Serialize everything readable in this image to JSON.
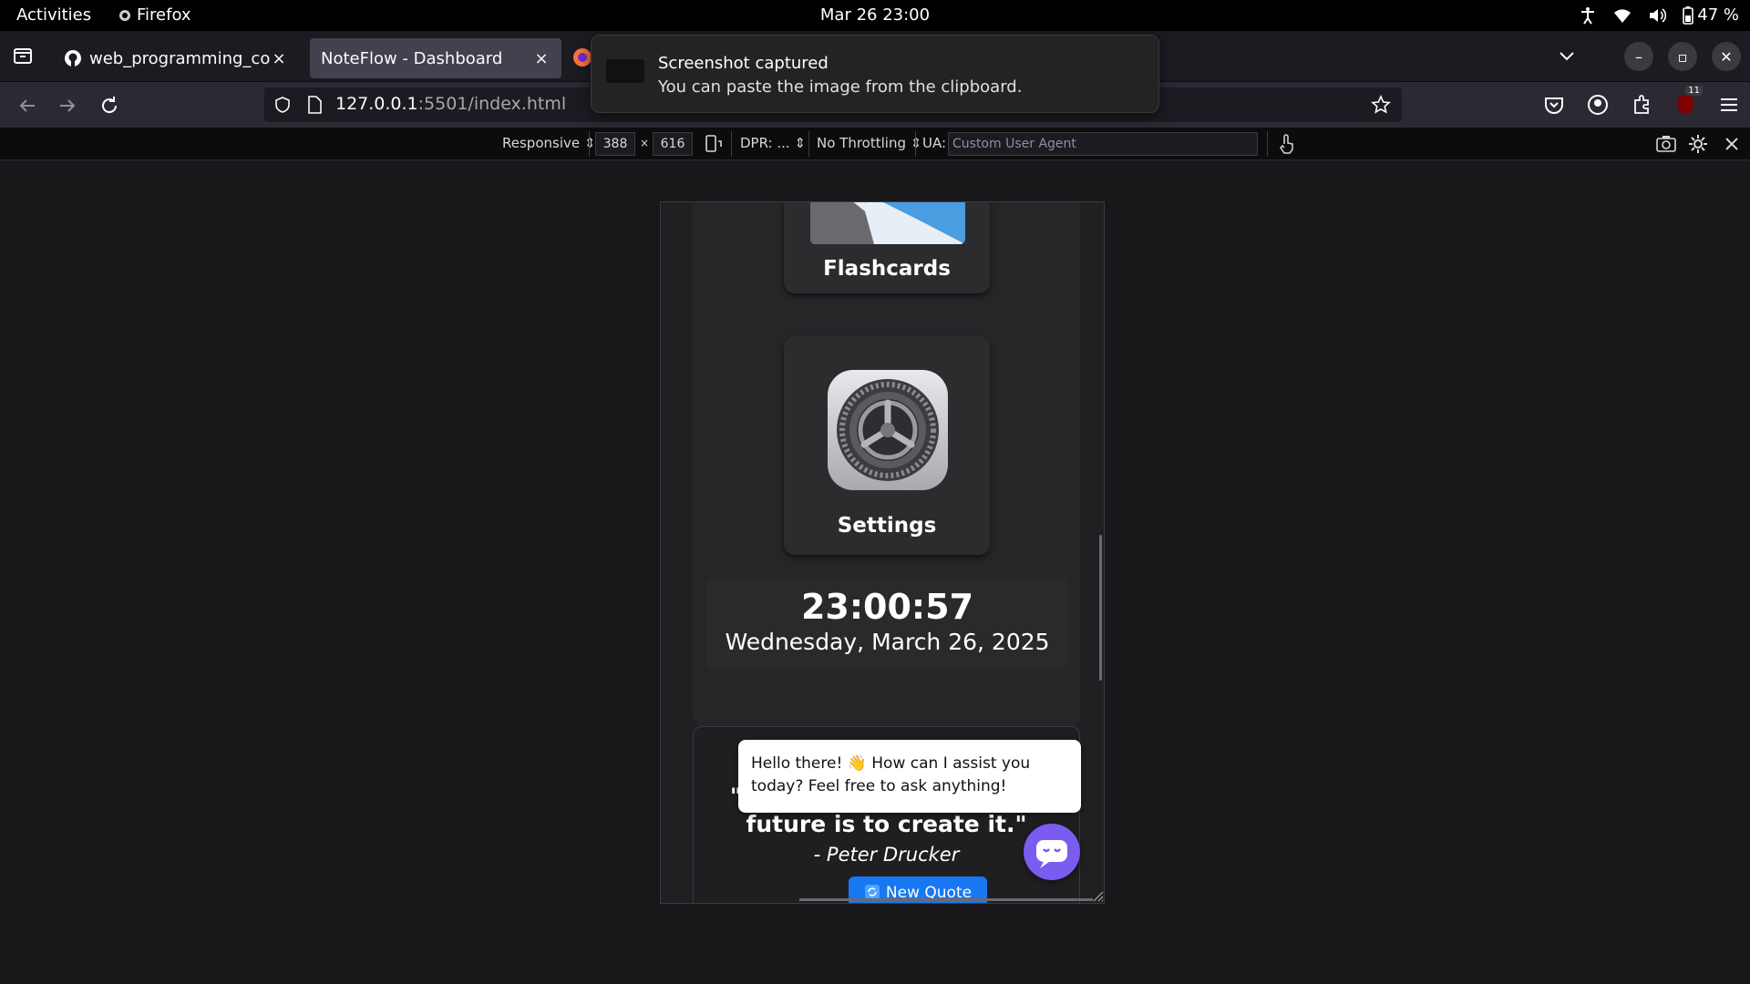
{
  "topbar": {
    "activities": "Activities",
    "app_name": "Firefox",
    "clock": "Mar 26  23:00",
    "battery": "47 %"
  },
  "tabs": [
    {
      "title": "web_programming_code",
      "close": "×"
    },
    {
      "title": "NoteFlow - Dashboard",
      "close": "×"
    }
  ],
  "notification": {
    "title": "Screenshot captured",
    "body": "You can paste the image from the clipboard."
  },
  "navbar": {
    "url_host": "127.0.0.1",
    "url_rest": ":5501/index.html",
    "extension_badge": "11"
  },
  "rdm": {
    "device": "Responsive",
    "width": "388",
    "times": "×",
    "height": "616",
    "dpr": "DPR: ...",
    "throttling": "No Throttling",
    "ua_label": "UA:",
    "ua_placeholder": "Custom User Agent"
  },
  "page": {
    "flashcards_label": "Flashcards",
    "settings_label": "Settings",
    "time": "23:00:57",
    "date": "Wednesday, March 26, 2025",
    "quote_open": "\"",
    "quote_tail": "future is to create it.\"",
    "quote_author": "- Peter Drucker",
    "new_quote_label": "New Quote",
    "chat_message": "Hello there! 👋 How can I assist you today? Feel free to ask anything!"
  }
}
